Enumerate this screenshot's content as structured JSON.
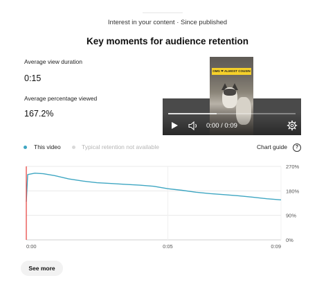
{
  "header": {
    "subtitle": "Interest in your content · Since published",
    "title": "Key moments for audience retention"
  },
  "metrics": {
    "avg_view_duration_label": "Average view duration",
    "avg_view_duration_value": "0:15",
    "avg_pct_viewed_label": "Average percentage viewed",
    "avg_pct_viewed_value": "167.2%"
  },
  "player": {
    "thumbnail_caption": "OMG ❤ ALMOST COUSIN",
    "time_display": "0:00 / 0:09",
    "progress_fraction": 0.38,
    "icons": [
      "play-icon",
      "volume-icon",
      "settings-gear-icon"
    ]
  },
  "legend": {
    "this_video": "This video",
    "typical": "Typical retention not available",
    "chart_guide": "Chart guide",
    "help": "?",
    "colors": {
      "this_video": "#3ea6c2",
      "typical": "#d9d9d9"
    }
  },
  "chart_data": {
    "type": "line",
    "xlabel": "",
    "ylabel": "",
    "x_tick_labels": [
      "0:00",
      "0:05",
      "0:09"
    ],
    "y_tick_labels": [
      "270%",
      "180%",
      "90%",
      "0%"
    ],
    "xlim": [
      0,
      9
    ],
    "ylim": [
      0,
      270
    ],
    "grid": true,
    "series": [
      {
        "name": "This video",
        "color": "#3ea6c2",
        "x": [
          0,
          0.05,
          0.3,
          0.6,
          1.0,
          1.5,
          2.0,
          2.5,
          3.0,
          3.5,
          4.0,
          4.5,
          5.0,
          5.5,
          6.0,
          6.5,
          7.0,
          7.5,
          8.0,
          8.5,
          9.0
        ],
        "y": [
          140,
          240,
          245,
          243,
          236,
          224,
          216,
          210,
          207,
          204,
          201,
          197,
          188,
          182,
          175,
          170,
          166,
          162,
          157,
          151,
          147
        ]
      }
    ],
    "marker_x": 0,
    "marker_color": "#e53935"
  },
  "actions": {
    "see_more": "See more"
  }
}
